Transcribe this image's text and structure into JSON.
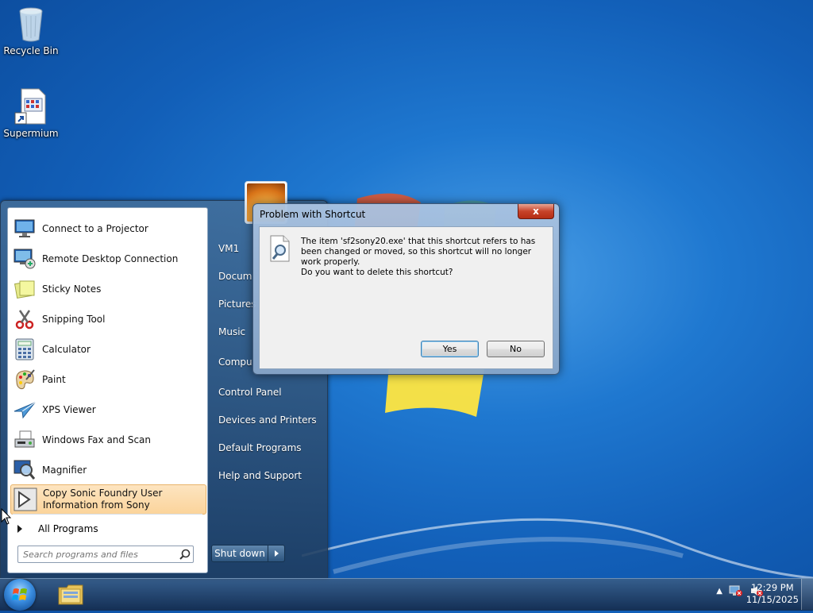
{
  "desktop": {
    "icons": [
      {
        "label": "Recycle Bin",
        "icon": "recycle-bin-icon"
      },
      {
        "label": "Supermium",
        "icon": "supermium-shortcut-icon"
      }
    ]
  },
  "start_menu": {
    "programs": [
      {
        "label": "Connect to a Projector",
        "icon": "projector-icon"
      },
      {
        "label": "Remote Desktop Connection",
        "icon": "remote-desktop-icon"
      },
      {
        "label": "Sticky Notes",
        "icon": "sticky-notes-icon"
      },
      {
        "label": "Snipping Tool",
        "icon": "scissors-icon"
      },
      {
        "label": "Calculator",
        "icon": "calculator-icon"
      },
      {
        "label": "Paint",
        "icon": "paint-palette-icon"
      },
      {
        "label": "XPS Viewer",
        "icon": "xps-viewer-icon"
      },
      {
        "label": "Windows Fax and Scan",
        "icon": "fax-icon"
      },
      {
        "label": "Magnifier",
        "icon": "magnifier-icon"
      },
      {
        "label": "Copy Sonic Foundry User Information from Sony",
        "icon": "shortcut-arrow-icon"
      }
    ],
    "all_programs": "All Programs",
    "search_placeholder": "Search programs and files",
    "right_items": [
      "VM1",
      "Documents",
      "Pictures",
      "Music",
      "Computer",
      "Control Panel",
      "Devices and Printers",
      "Default Programs",
      "Help and Support"
    ],
    "right_items_visible": [
      "VM1",
      "Docume",
      "Pictures",
      "Music",
      "Comput",
      "Control Panel",
      "Devices and Printers",
      "Default Programs",
      "Help and Support"
    ],
    "shutdown_label": "Shut down"
  },
  "dialog": {
    "title": "Problem with Shortcut",
    "close_label": "x",
    "message": "The item 'sf2sony20.exe' that this shortcut refers to has been changed or moved, so this shortcut will no longer work properly.",
    "question": "Do you want to delete this shortcut?",
    "yes_label": "Yes",
    "no_label": "No"
  },
  "taskbar": {
    "time": "12:29 PM",
    "date": "11/15/2025"
  }
}
